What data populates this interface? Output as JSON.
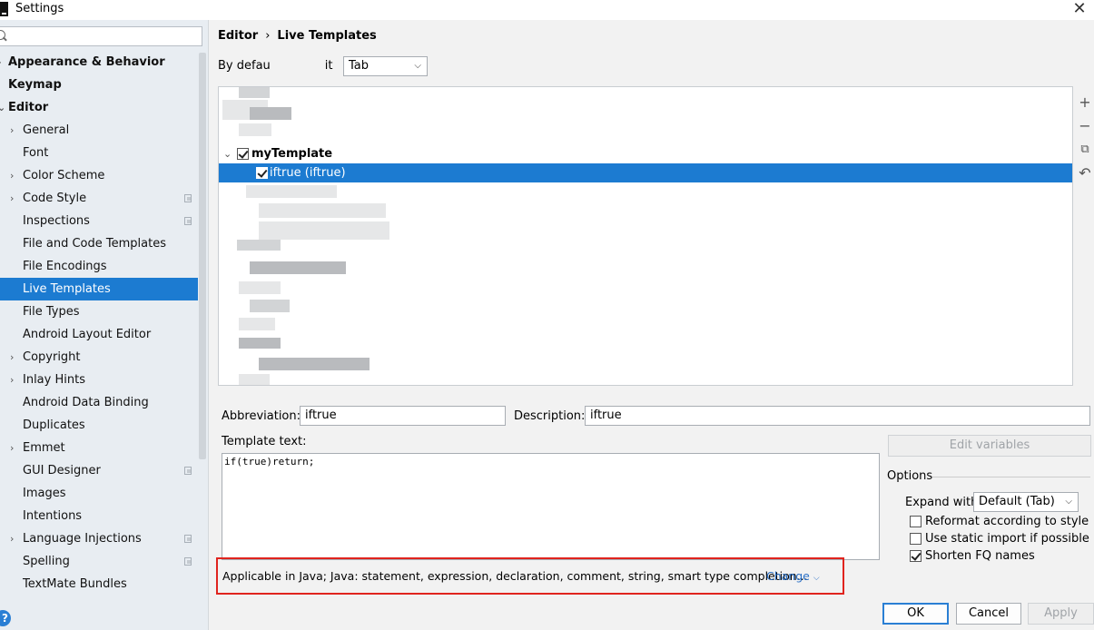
{
  "window": {
    "title": "Settings",
    "close_label": "✕"
  },
  "sidebar": {
    "search_value": "",
    "items": [
      {
        "label": "Appearance & Behavior",
        "bold": true,
        "level": 0,
        "arrow": "›"
      },
      {
        "label": "Keymap",
        "bold": true,
        "level": 0,
        "arrow": ""
      },
      {
        "label": "Editor",
        "bold": true,
        "level": 0,
        "arrow": "⌄"
      },
      {
        "label": "General",
        "level": 1,
        "arrow": "›"
      },
      {
        "label": "Font",
        "level": 1,
        "arrow": ""
      },
      {
        "label": "Color Scheme",
        "level": 1,
        "arrow": "›"
      },
      {
        "label": "Code Style",
        "level": 1,
        "arrow": "›",
        "copy": true
      },
      {
        "label": "Inspections",
        "level": 1,
        "arrow": "",
        "copy": true
      },
      {
        "label": "File and Code Templates",
        "level": 1,
        "arrow": ""
      },
      {
        "label": "File Encodings",
        "level": 1,
        "arrow": ""
      },
      {
        "label": "Live Templates",
        "level": 1,
        "arrow": "",
        "selected": true
      },
      {
        "label": "File Types",
        "level": 1,
        "arrow": ""
      },
      {
        "label": "Android Layout Editor",
        "level": 1,
        "arrow": ""
      },
      {
        "label": "Copyright",
        "level": 1,
        "arrow": "›"
      },
      {
        "label": "Inlay Hints",
        "level": 1,
        "arrow": "›"
      },
      {
        "label": "Android Data Binding",
        "level": 1,
        "arrow": ""
      },
      {
        "label": "Duplicates",
        "level": 1,
        "arrow": ""
      },
      {
        "label": "Emmet",
        "level": 1,
        "arrow": "›"
      },
      {
        "label": "GUI Designer",
        "level": 1,
        "arrow": "",
        "copy": true
      },
      {
        "label": "Images",
        "level": 1,
        "arrow": ""
      },
      {
        "label": "Intentions",
        "level": 1,
        "arrow": ""
      },
      {
        "label": "Language Injections",
        "level": 1,
        "arrow": "›",
        "copy": true
      },
      {
        "label": "Spelling",
        "level": 1,
        "arrow": "",
        "copy": true
      },
      {
        "label": "TextMate Bundles",
        "level": 1,
        "arrow": ""
      }
    ],
    "help_label": "?"
  },
  "breadcrumb": {
    "parent": "Editor",
    "sep": "›",
    "current": "Live Templates"
  },
  "expand_default": {
    "label_prefix": "By defau",
    "label_suffix": "it",
    "value": "Tab"
  },
  "templates": {
    "group": {
      "label": "myTemplate",
      "checked": true
    },
    "selected_item": {
      "label": "iftrue (iftrue)",
      "checked": true
    }
  },
  "toolbar": {
    "add": "+",
    "remove": "−",
    "copy": "⧉",
    "restore": "↶"
  },
  "form": {
    "abbreviation_label": "Abbreviation:",
    "abbreviation_value": "iftrue",
    "description_label": "Description:",
    "description_value": "iftrue",
    "template_text_label": "Template text:",
    "template_text_value": "if(true)return;",
    "edit_variables": "Edit variables"
  },
  "options": {
    "title": "Options",
    "expand_with_label": "Expand with",
    "expand_with_value": "Default (Tab)",
    "reformat": {
      "label": "Reformat according to style",
      "checked": false
    },
    "static_import": {
      "label": "Use static import if possible",
      "checked": false
    },
    "shorten_fq": {
      "label": "Shorten FQ names",
      "checked": true
    }
  },
  "applicable": {
    "text": "Applicable in Java; Java: statement, expression, declaration, comment, string, smart type completion...",
    "change_label": "Change"
  },
  "buttons": {
    "ok": "OK",
    "cancel": "Cancel",
    "apply": "Apply"
  }
}
